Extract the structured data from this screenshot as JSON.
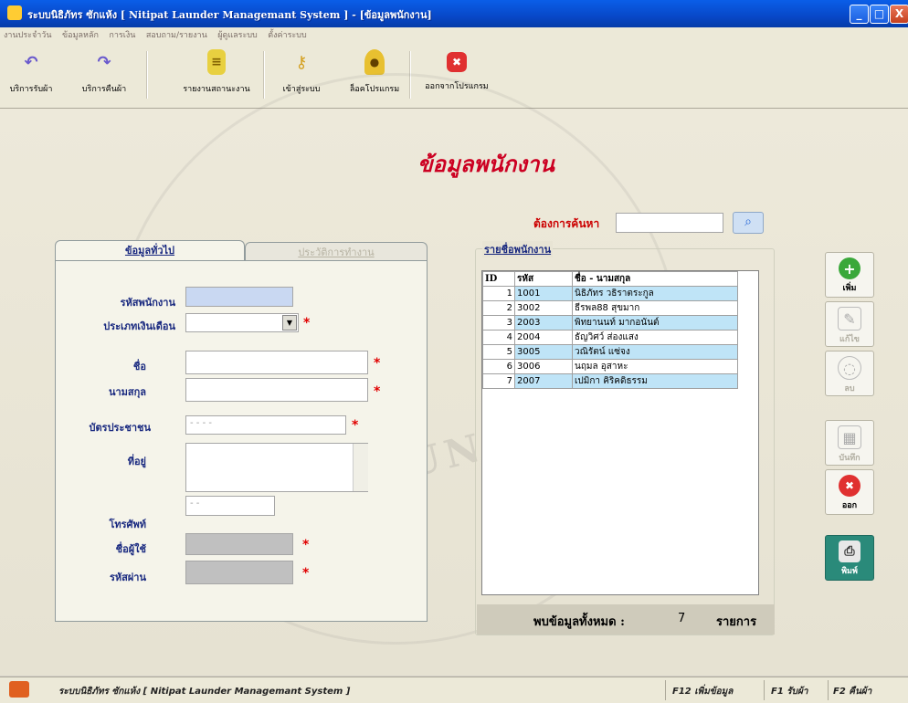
{
  "window": {
    "title": "ระบบนิธิภัทร ซักแห้ง [ Nitipat Launder Managemant System ] - [ข้อมูลพนักงาน]",
    "min": "_",
    "max": "□",
    "close": "X"
  },
  "menu": [
    "งานประจำวัน",
    "ข้อมูลหลัก",
    "การเงิน",
    "สอบถาม/รายงาน",
    "ผู้ดูแลระบบ",
    "ตั้งค่าระบบ"
  ],
  "toolbar": {
    "receive": "บริการรับผ้า",
    "return": "บริการคืนผ้า",
    "report": "รายงานสถานะงาน",
    "login": "เข้าสู่ระบบ",
    "lock": "ล็อคโปรแกรม",
    "exit": "ออกจากโปรแกรม"
  },
  "page_title": "ข้อมูลพนักงาน",
  "search": {
    "label": "ต้องการค้นหา",
    "value": ""
  },
  "tabs": {
    "general": "ข้อมูลทั่วไป",
    "history": "ประวัติการทำงาน"
  },
  "form": {
    "emp_id": "รหัสพนักงาน",
    "salary_type": "ประเภทเงินเดือน",
    "first_name": "ชื่อ",
    "last_name": "นามสกุล",
    "id_card": "บัตรประชาชน",
    "id_card_value": "- - - -",
    "address": "ที่อยู่",
    "phone": "โทรศัพท์",
    "phone_value": "- -",
    "username": "ชื่อผู้ใช้",
    "password": "รหัสผ่าน",
    "req": "*"
  },
  "grid": {
    "group_title": "รายชื่อพนักงาน",
    "headers": [
      "ID",
      "รหัส",
      "ชื่อ - นามสกุล"
    ],
    "rows": [
      {
        "id": "1",
        "code": "1001",
        "name": "นิธิภัทร วธิราตระกูล"
      },
      {
        "id": "2",
        "code": "3002",
        "name": "ธีรพล88 สุขมาก"
      },
      {
        "id": "3",
        "code": "2003",
        "name": "พิทยานนท์ มากอนันต์"
      },
      {
        "id": "4",
        "code": "2004",
        "name": "ธัญวิศว์ ส่องแสง"
      },
      {
        "id": "5",
        "code": "3005",
        "name": "วณิรัตน์ แซ่จง"
      },
      {
        "id": "6",
        "code": "3006",
        "name": "นฤมล อุสาหะ"
      },
      {
        "id": "7",
        "code": "2007",
        "name": "เปมิกา คิริคดิธรรม"
      }
    ]
  },
  "count": {
    "label": "พบข้อมูลทั้งหมด :",
    "value": "7",
    "unit": "รายการ"
  },
  "side": {
    "add": "เพิ่ม",
    "edit": "แก้ไข",
    "delete": "ลบ",
    "save": "บันทึก",
    "exit": "ออก",
    "print": "พิมพ์"
  },
  "status": {
    "app": "ระบบนิธิภัทร ซักแห้ง [ Nitipat Launder Managemant System ]",
    "f12": "F12 เพิ่มข้อมูล",
    "f1": "F1 รับผ้า",
    "f2": "F2 คืนผ้า"
  },
  "watermark": "RAJABHAT UNIVERSITY",
  "colors": {
    "title_red": "#cc0022",
    "label_navy": "#1a2a80",
    "grid_highlight": "#bfe4f7",
    "xp_blue": "#0848c8"
  }
}
